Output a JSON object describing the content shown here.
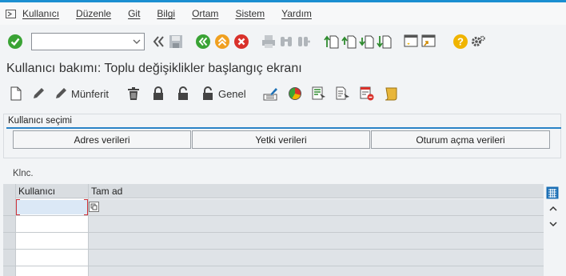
{
  "menu": {
    "items": [
      "Kullanıcı",
      "Düzenle",
      "Git",
      "Bilgi",
      "Ortam",
      "Sistem",
      "Yardım"
    ]
  },
  "command_field": {
    "value": "",
    "placeholder": ""
  },
  "page_title": "Kullanıcı bakımı: Toplu değişiklikler başlangıç ekranı",
  "app_toolbar": {
    "munferit_label": "Münferit",
    "genel_label": "Genel"
  },
  "group": {
    "title": "Kullanıcı seçimi",
    "buttons": [
      "Adres verileri",
      "Yetki verileri",
      "Oturum açma verileri"
    ]
  },
  "table": {
    "label": "Klnc.",
    "columns": [
      "Kullanıcı",
      "Tam ad"
    ]
  },
  "colors": {
    "accent": "#1b8fd1",
    "ok_green": "#3aa335",
    "cancel_red": "#d9312b",
    "exit_orange": "#f0a020",
    "help_yellow": "#f0b400"
  }
}
